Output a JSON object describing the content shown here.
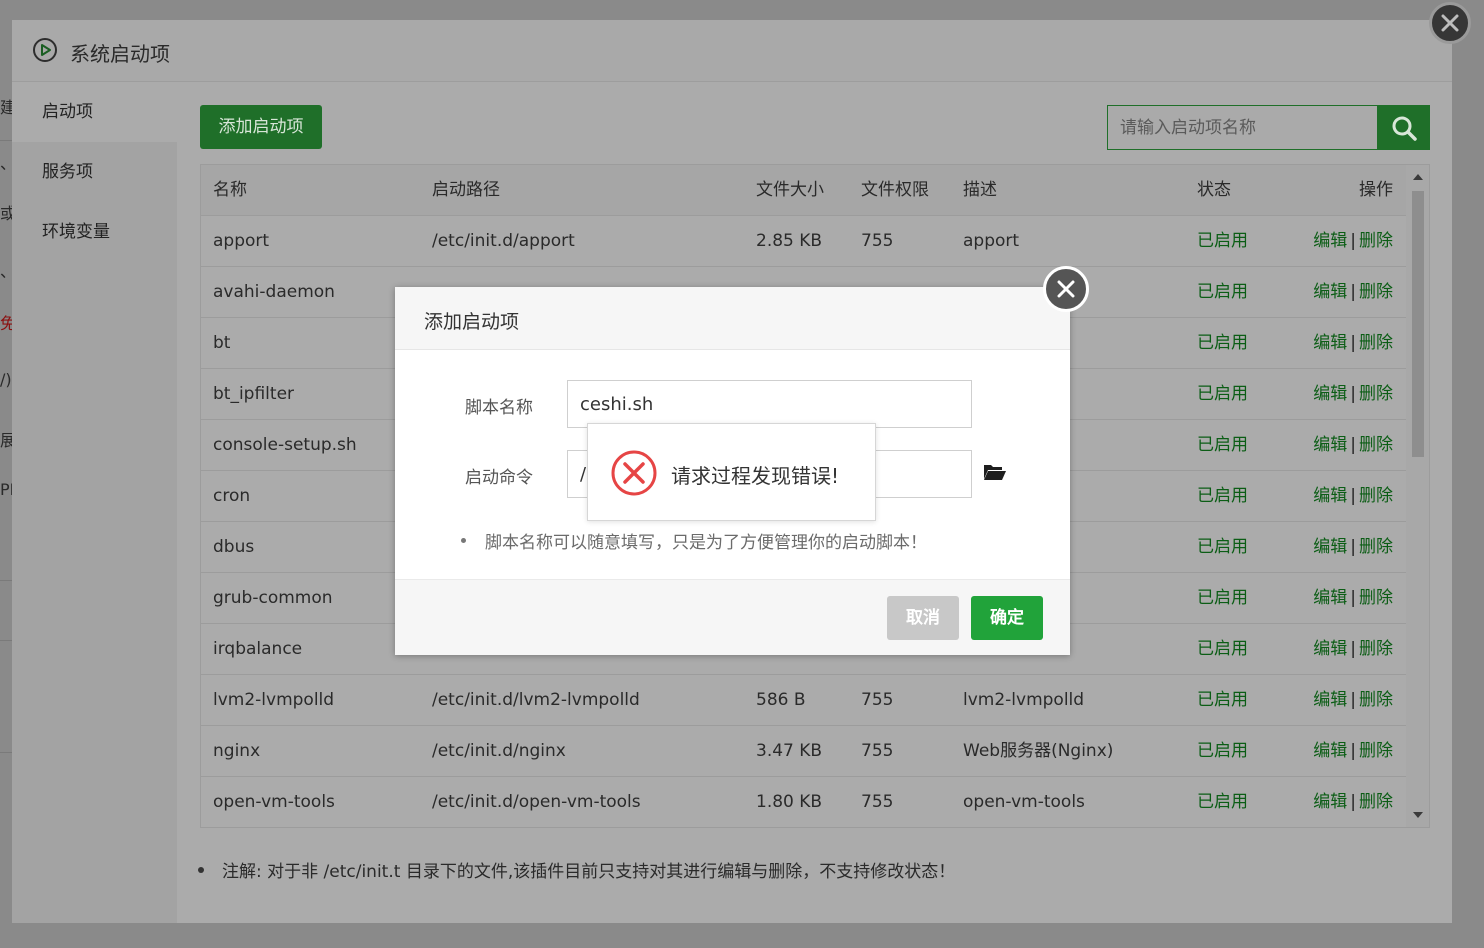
{
  "background_fragments": [
    "建",
    "、",
    "或",
    "、",
    "免",
    "/)",
    "展",
    "PH"
  ],
  "main_dialog": {
    "title": "系统启动项",
    "icon": "play-circle-icon",
    "sidebar": [
      {
        "label": "启动项",
        "active": true
      },
      {
        "label": "服务项",
        "active": false
      },
      {
        "label": "环境变量",
        "active": false
      }
    ],
    "toolbar": {
      "add_label": "添加启动项",
      "search_placeholder": "请输入启动项名称"
    },
    "table": {
      "headers": {
        "name": "名称",
        "path": "启动路径",
        "size": "文件大小",
        "perm": "文件权限",
        "desc": "描述",
        "status": "状态",
        "ops": "操作"
      },
      "rows": [
        {
          "name": "apport",
          "path": "/etc/init.d/apport",
          "size": "2.85 KB",
          "perm": "755",
          "desc": "apport",
          "status": "已启用"
        },
        {
          "name": "avahi-daemon",
          "path": "",
          "size": "",
          "perm": "",
          "desc": "",
          "status": "已启用"
        },
        {
          "name": "bt",
          "path": "",
          "size": "",
          "perm": "",
          "desc": "",
          "status": "已启用"
        },
        {
          "name": "bt_ipfilter",
          "path": "",
          "size": "",
          "perm": "",
          "desc": "",
          "status": "已启用"
        },
        {
          "name": "console-setup.sh",
          "path": "",
          "size": "",
          "perm": "",
          "desc": "",
          "status": "已启用"
        },
        {
          "name": "cron",
          "path": "",
          "size": "",
          "perm": "",
          "desc": "",
          "status": "已启用"
        },
        {
          "name": "dbus",
          "path": "",
          "size": "",
          "perm": "",
          "desc": "",
          "status": "已启用"
        },
        {
          "name": "grub-common",
          "path": "",
          "size": "",
          "perm": "",
          "desc": "",
          "status": "已启用"
        },
        {
          "name": "irqbalance",
          "path": "",
          "size": "",
          "perm": "",
          "desc": "",
          "status": "已启用"
        },
        {
          "name": "lvm2-lvmpolld",
          "path": "/etc/init.d/lvm2-lvmpolld",
          "size": "586 B",
          "perm": "755",
          "desc": "lvm2-lvmpolld",
          "status": "已启用"
        },
        {
          "name": "nginx",
          "path": "/etc/init.d/nginx",
          "size": "3.47 KB",
          "perm": "755",
          "desc": "Web服务器(Nginx)",
          "status": "已启用"
        },
        {
          "name": "open-vm-tools",
          "path": "/etc/init.d/open-vm-tools",
          "size": "1.80 KB",
          "perm": "755",
          "desc": "open-vm-tools",
          "status": "已启用"
        }
      ],
      "edit_label": "编辑",
      "sep": "|",
      "delete_label": "删除"
    },
    "note": "注解: 对于非 /etc/init.t 目录下的文件,该插件目前只支持对其进行编辑与删除，不支持修改状态！"
  },
  "add_dialog": {
    "title": "添加启动项",
    "script_name_label": "脚本名称",
    "script_name_value": "ceshi.sh",
    "command_label": "启动命令",
    "command_value": "/",
    "tip": "脚本名称可以随意填写，只是为了方便管理你的启动脚本！",
    "cancel_label": "取消",
    "ok_label": "确定"
  },
  "error_toast": {
    "message": "请求过程发现错误!",
    "icon": "error-x-icon"
  },
  "colors": {
    "green": "#20a53a",
    "error_red": "#e64545"
  }
}
